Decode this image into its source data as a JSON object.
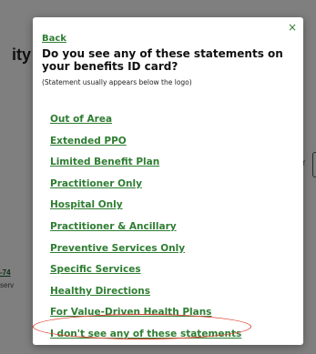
{
  "background": {
    "heading_fragment": "ity",
    "link_fragment": "-74",
    "small_fragment": "serv",
    "side_fragment": "r"
  },
  "modal": {
    "close_label": "×",
    "back_label": "Back",
    "question": "Do you see any of these statements on your benefits ID card?",
    "hint": "(Statement usually appears below the logo)",
    "options": [
      "Out of Area",
      "Extended PPO",
      "Limited Benefit Plan",
      "Practitioner Only",
      "Hospital Only",
      "Practitioner & Ancillary",
      "Preventive Services Only",
      "Specific Services",
      "Healthy Directions",
      "For Value-Driven Health Plans",
      "I don't see any of these statements"
    ]
  },
  "colors": {
    "link": "#2e7d32",
    "highlight": "#e04030",
    "overlay": "rgba(0,0,0,0.5)"
  }
}
